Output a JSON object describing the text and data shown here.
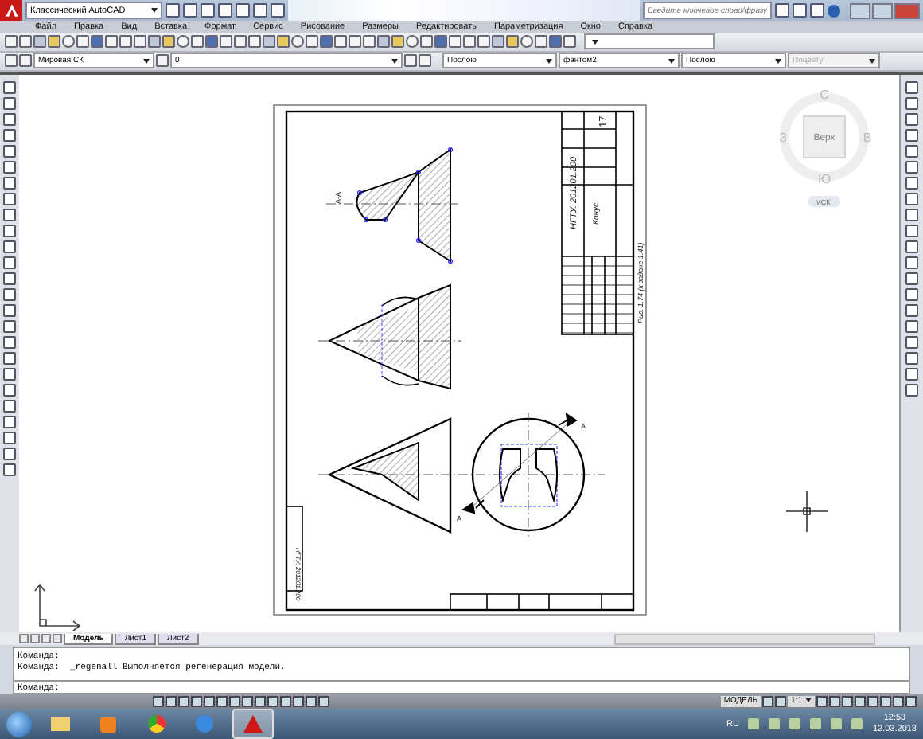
{
  "title_bar": {
    "workspace": "Классический AutoCAD",
    "search": {
      "placeholder": "Введите ключевое слово/фразу"
    }
  },
  "menu": [
    "Файл",
    "Правка",
    "Вид",
    "Вставка",
    "Формат",
    "Сервис",
    "Рисование",
    "Размеры",
    "Редактировать",
    "Параметризация",
    "Окно",
    "Справка"
  ],
  "properties_bar": {
    "ucs": "Мировая СК",
    "layer": "0",
    "object_color": "Послою",
    "linetype": "фантом2",
    "lineweight": "Послою",
    "plot_style": {
      "value": "Поцвету",
      "disabled": true
    }
  },
  "drawing": {
    "title_code": "НГТУ. 201201.200",
    "title_name": "Конус",
    "sheet": "17",
    "caption": "Рис. 1.74 (к задаче 1.41)",
    "section_label": "А-А",
    "stamp_code": "НГТУ. 201201.200",
    "cut_labels": [
      "А",
      "А"
    ]
  },
  "viewcube": {
    "face": "Верх",
    "north": "С",
    "south": "Ю",
    "west": "З",
    "east": "В",
    "ucs": "МСК"
  },
  "layout_tabs": [
    {
      "label": "Модель",
      "selected": true
    },
    {
      "label": "Лист1",
      "selected": false
    },
    {
      "label": "Лист2",
      "selected": false
    }
  ],
  "command_history": [
    "Команда:",
    "Команда:  _regenall Выполняется регенерация модели."
  ],
  "command_prompt": "Команда:",
  "status_bar": {
    "space": "МОДЕЛЬ",
    "scale": "1:1"
  },
  "taskbar": {
    "language": "RU",
    "time": "12:53",
    "date": "12.03.2013"
  }
}
